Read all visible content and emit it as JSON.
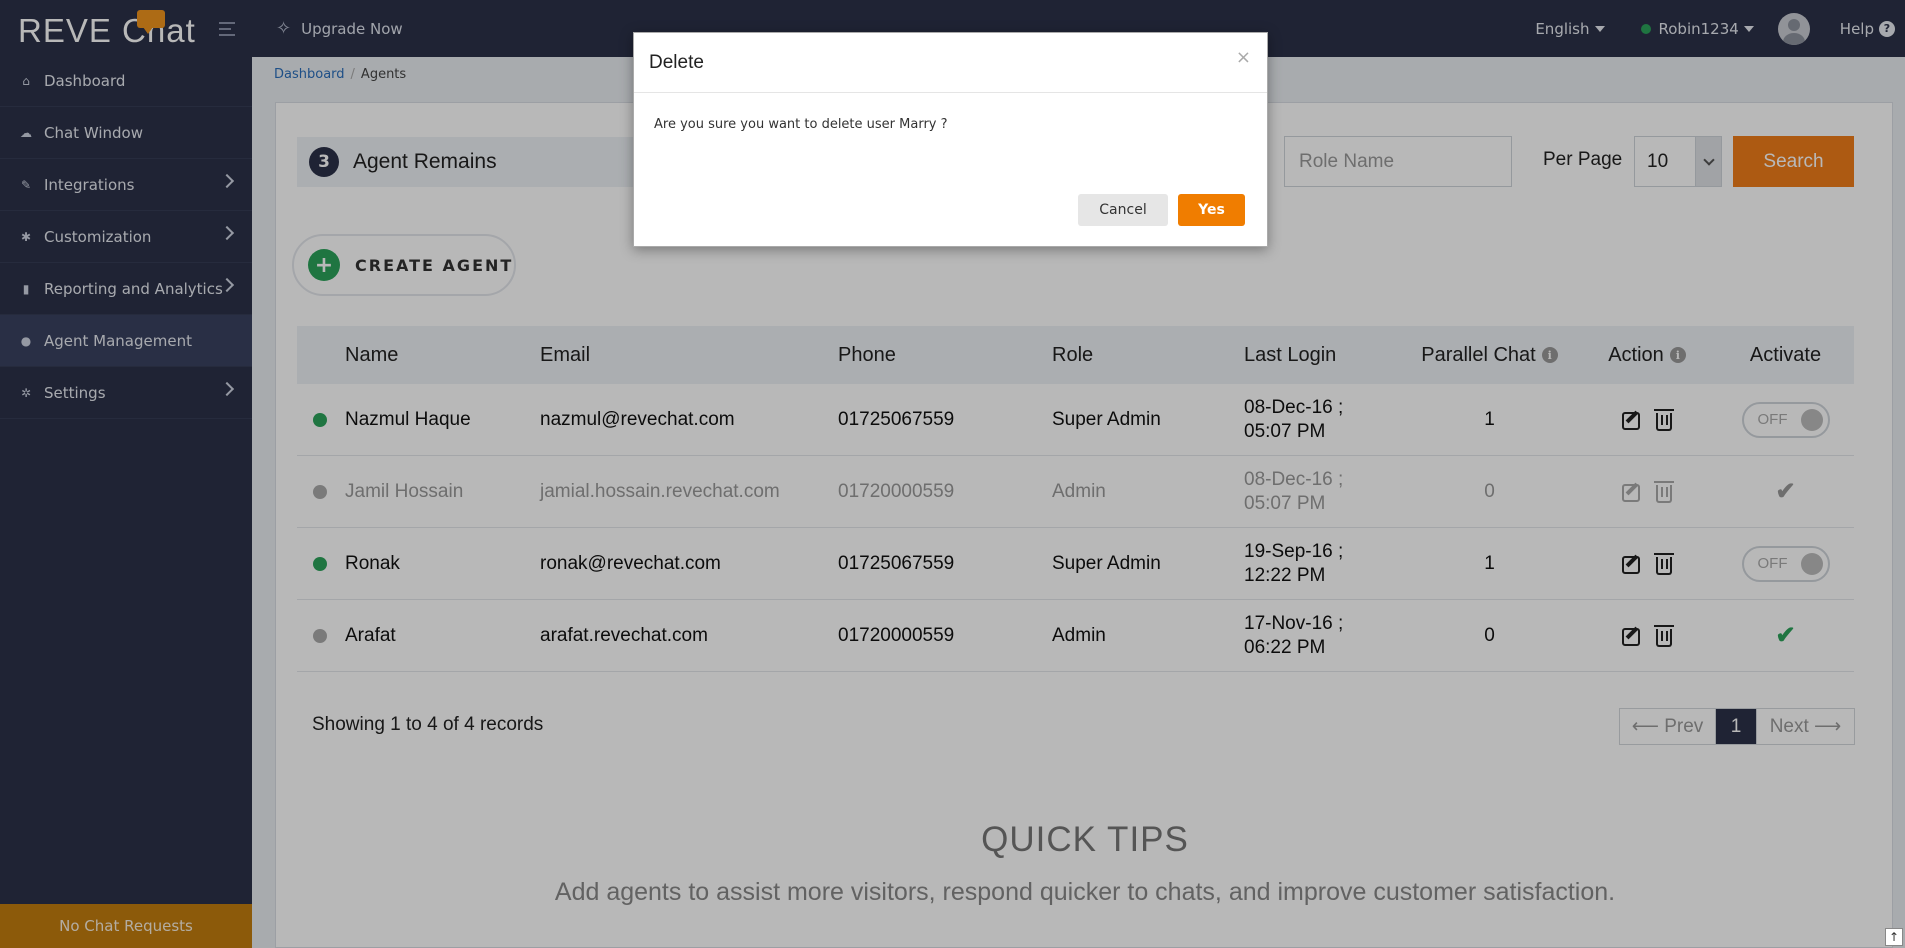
{
  "app": {
    "logo_text": "REVE Chat"
  },
  "sidebar": {
    "items": [
      {
        "label": "Dashboard",
        "icon": "home-icon",
        "has_chevron": false
      },
      {
        "label": "Chat Window",
        "icon": "chat-icon",
        "has_chevron": false
      },
      {
        "label": "Integrations",
        "icon": "plug-icon",
        "has_chevron": true
      },
      {
        "label": "Customization",
        "icon": "gear-icon",
        "has_chevron": true
      },
      {
        "label": "Reporting and Analytics",
        "icon": "bar-chart-icon",
        "has_chevron": true
      },
      {
        "label": "Agent Management",
        "icon": "user-icon",
        "has_chevron": false,
        "active": true
      },
      {
        "label": "Settings",
        "icon": "cogs-icon",
        "has_chevron": true
      }
    ],
    "footer": "No Chat Requests"
  },
  "topbar": {
    "upgrade_label": "Upgrade Now",
    "language": "English",
    "username": "Robin1234",
    "help_label": "Help"
  },
  "breadcrumb": {
    "home": "Dashboard",
    "current": "Agents"
  },
  "agents_panel": {
    "remains_count": "3",
    "remains_label": "Agent Remains",
    "role_placeholder": "Role Name",
    "per_page_label": "Per Page",
    "per_page_value": "10",
    "search_label": "Search",
    "create_label": "CREATE AGENT"
  },
  "table": {
    "headers": {
      "name": "Name",
      "email": "Email",
      "phone": "Phone",
      "role": "Role",
      "last_login": "Last Login",
      "parallel_chat": "Parallel Chat",
      "action": "Action",
      "activate": "Activate"
    },
    "rows": [
      {
        "name": "Nazmul Haque",
        "email": "nazmul@revechat.com",
        "phone": "01725067559",
        "role": "Super Admin",
        "login_date": "08-Dec-16 ;",
        "login_time": "05:07 PM",
        "parallel": "1",
        "status": "online",
        "activate": "toggle",
        "toggle_label": "OFF"
      },
      {
        "name": "Jamil Hossain",
        "email": "jamial.hossain.revechat.com",
        "phone": "01720000559",
        "role": "Admin",
        "login_date": "08-Dec-16 ;",
        "login_time": "05:07 PM",
        "parallel": "0",
        "status": "inactive",
        "activate": "check-grey"
      },
      {
        "name": "Ronak",
        "email": "ronak@revechat.com",
        "phone": "01725067559",
        "role": "Super Admin",
        "login_date": "19-Sep-16 ;",
        "login_time": "12:22 PM",
        "parallel": "1",
        "status": "online",
        "activate": "toggle",
        "toggle_label": "OFF"
      },
      {
        "name": "Arafat",
        "email": "arafat.revechat.com",
        "phone": "01720000559",
        "role": "Admin",
        "login_date": "17-Nov-16 ;",
        "login_time": "06:22 PM",
        "parallel": "0",
        "status": "offline",
        "activate": "check-green"
      }
    ]
  },
  "pagination": {
    "summary": "Showing 1 to 4 of 4 records",
    "prev": "⟵ Prev",
    "current": "1",
    "next": "Next ⟶"
  },
  "quick_tips": {
    "title": "QUICK TIPS",
    "text": "Add agents to assist more visitors, respond quicker to chats, and improve customer satisfaction."
  },
  "modal": {
    "title": "Delete",
    "close": "×",
    "message": "Are you sure you want to delete user Marry ?",
    "cancel": "Cancel",
    "confirm": "Yes"
  },
  "colors": {
    "sidebar_bg": "#2b3148",
    "accent_orange": "#f07d1a",
    "online_green": "#2ba35a"
  }
}
